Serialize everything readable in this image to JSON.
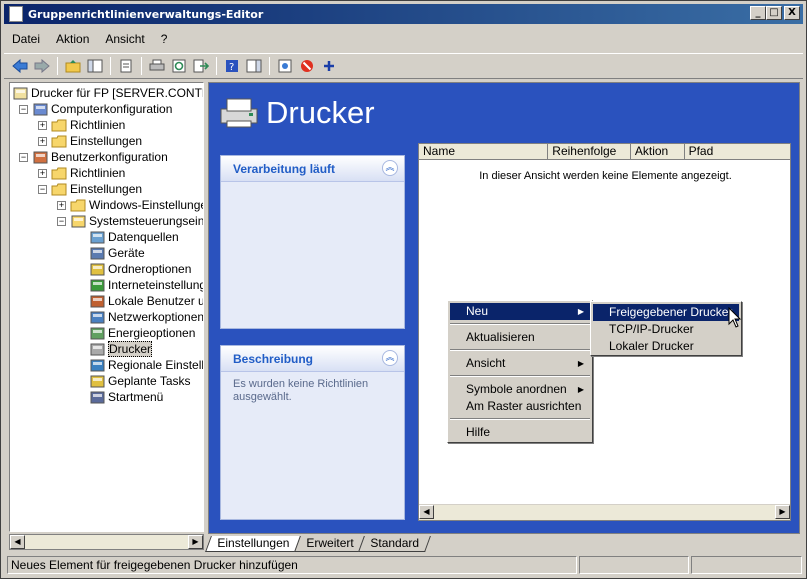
{
  "window": {
    "title": "Gruppenrichtlinienverwaltungs-Editor",
    "btn_min": "_",
    "btn_max": "□",
    "btn_close": "X"
  },
  "menu": [
    "Datei",
    "Aktion",
    "Ansicht",
    "?"
  ],
  "toolbar": {
    "icons": [
      "back-icon",
      "forward-icon",
      "up-folder-icon",
      "show-hide-tree-icon",
      "properties-icon",
      "print-icon",
      "refresh-icon",
      "export-icon",
      "help-icon",
      "show-hide-action-pane-icon",
      "new-window-icon",
      "stop-icon",
      "add-icon"
    ]
  },
  "tree": [
    {
      "label": "Drucker für FP [SERVER.CONTRAN",
      "indent": 0,
      "icon": "gpo-icon"
    },
    {
      "label": "Computerkonfiguration",
      "indent": 1,
      "exp": "−",
      "icon": "computer-icon"
    },
    {
      "label": "Richtlinien",
      "indent": 2,
      "exp": "+",
      "icon": "folder-icon"
    },
    {
      "label": "Einstellungen",
      "indent": 2,
      "exp": "+",
      "icon": "folder-icon"
    },
    {
      "label": "Benutzerkonfiguration",
      "indent": 1,
      "exp": "−",
      "icon": "users-icon"
    },
    {
      "label": "Richtlinien",
      "indent": 2,
      "exp": "+",
      "icon": "folder-icon"
    },
    {
      "label": "Einstellungen",
      "indent": 2,
      "exp": "−",
      "icon": "folder-icon"
    },
    {
      "label": "Windows-Einstellungen",
      "indent": 3,
      "exp": "+",
      "icon": "folder-icon"
    },
    {
      "label": "Systemsteuerungseinst",
      "indent": 3,
      "exp": "−",
      "icon": "control-panel-icon"
    },
    {
      "label": "Datenquellen",
      "indent": 4,
      "icon": "datasource-icon"
    },
    {
      "label": "Geräte",
      "indent": 4,
      "icon": "devices-icon"
    },
    {
      "label": "Ordneroptionen",
      "indent": 4,
      "icon": "folder-options-icon"
    },
    {
      "label": "Interneteinstellung",
      "indent": 4,
      "icon": "internet-icon"
    },
    {
      "label": "Lokale Benutzer un",
      "indent": 4,
      "icon": "local-users-icon"
    },
    {
      "label": "Netzwerkoptionen",
      "indent": 4,
      "icon": "network-icon"
    },
    {
      "label": "Energieoptionen",
      "indent": 4,
      "icon": "power-icon"
    },
    {
      "label": "Drucker",
      "indent": 4,
      "icon": "printer-icon",
      "selected": true
    },
    {
      "label": "Regionale Einstellu",
      "indent": 4,
      "icon": "regional-icon"
    },
    {
      "label": "Geplante Tasks",
      "indent": 4,
      "icon": "scheduled-tasks-icon"
    },
    {
      "label": "Startmenü",
      "indent": 4,
      "icon": "start-menu-icon"
    }
  ],
  "main": {
    "heading": "Drucker",
    "panel1": {
      "title": "Verarbeitung läuft",
      "btn": "︽"
    },
    "panel2": {
      "title": "Beschreibung",
      "btn": "︽",
      "text": "Es wurden keine Richtlinien ausgewählt."
    },
    "columns": [
      "Name",
      "Reihenfolge",
      "Aktion",
      "Pfad"
    ],
    "empty": "In dieser Ansicht werden keine Elemente angezeigt."
  },
  "context_menu": [
    {
      "label": "Neu",
      "sub": true,
      "highlight": true
    },
    {
      "sep": true
    },
    {
      "label": "Aktualisieren"
    },
    {
      "sep": true
    },
    {
      "label": "Ansicht",
      "sub": true
    },
    {
      "sep": true
    },
    {
      "label": "Symbole anordnen",
      "sub": true
    },
    {
      "label": "Am Raster ausrichten"
    },
    {
      "sep": true
    },
    {
      "label": "Hilfe"
    }
  ],
  "submenu": [
    {
      "label": "Freigegebener Drucker",
      "highlight": true
    },
    {
      "label": "TCP/IP-Drucker"
    },
    {
      "label": "Lokaler Drucker"
    }
  ],
  "tabs": [
    "Einstellungen",
    "Erweitert",
    "Standard"
  ],
  "status": "Neues Element für freigegebenen Drucker hinzufügen"
}
